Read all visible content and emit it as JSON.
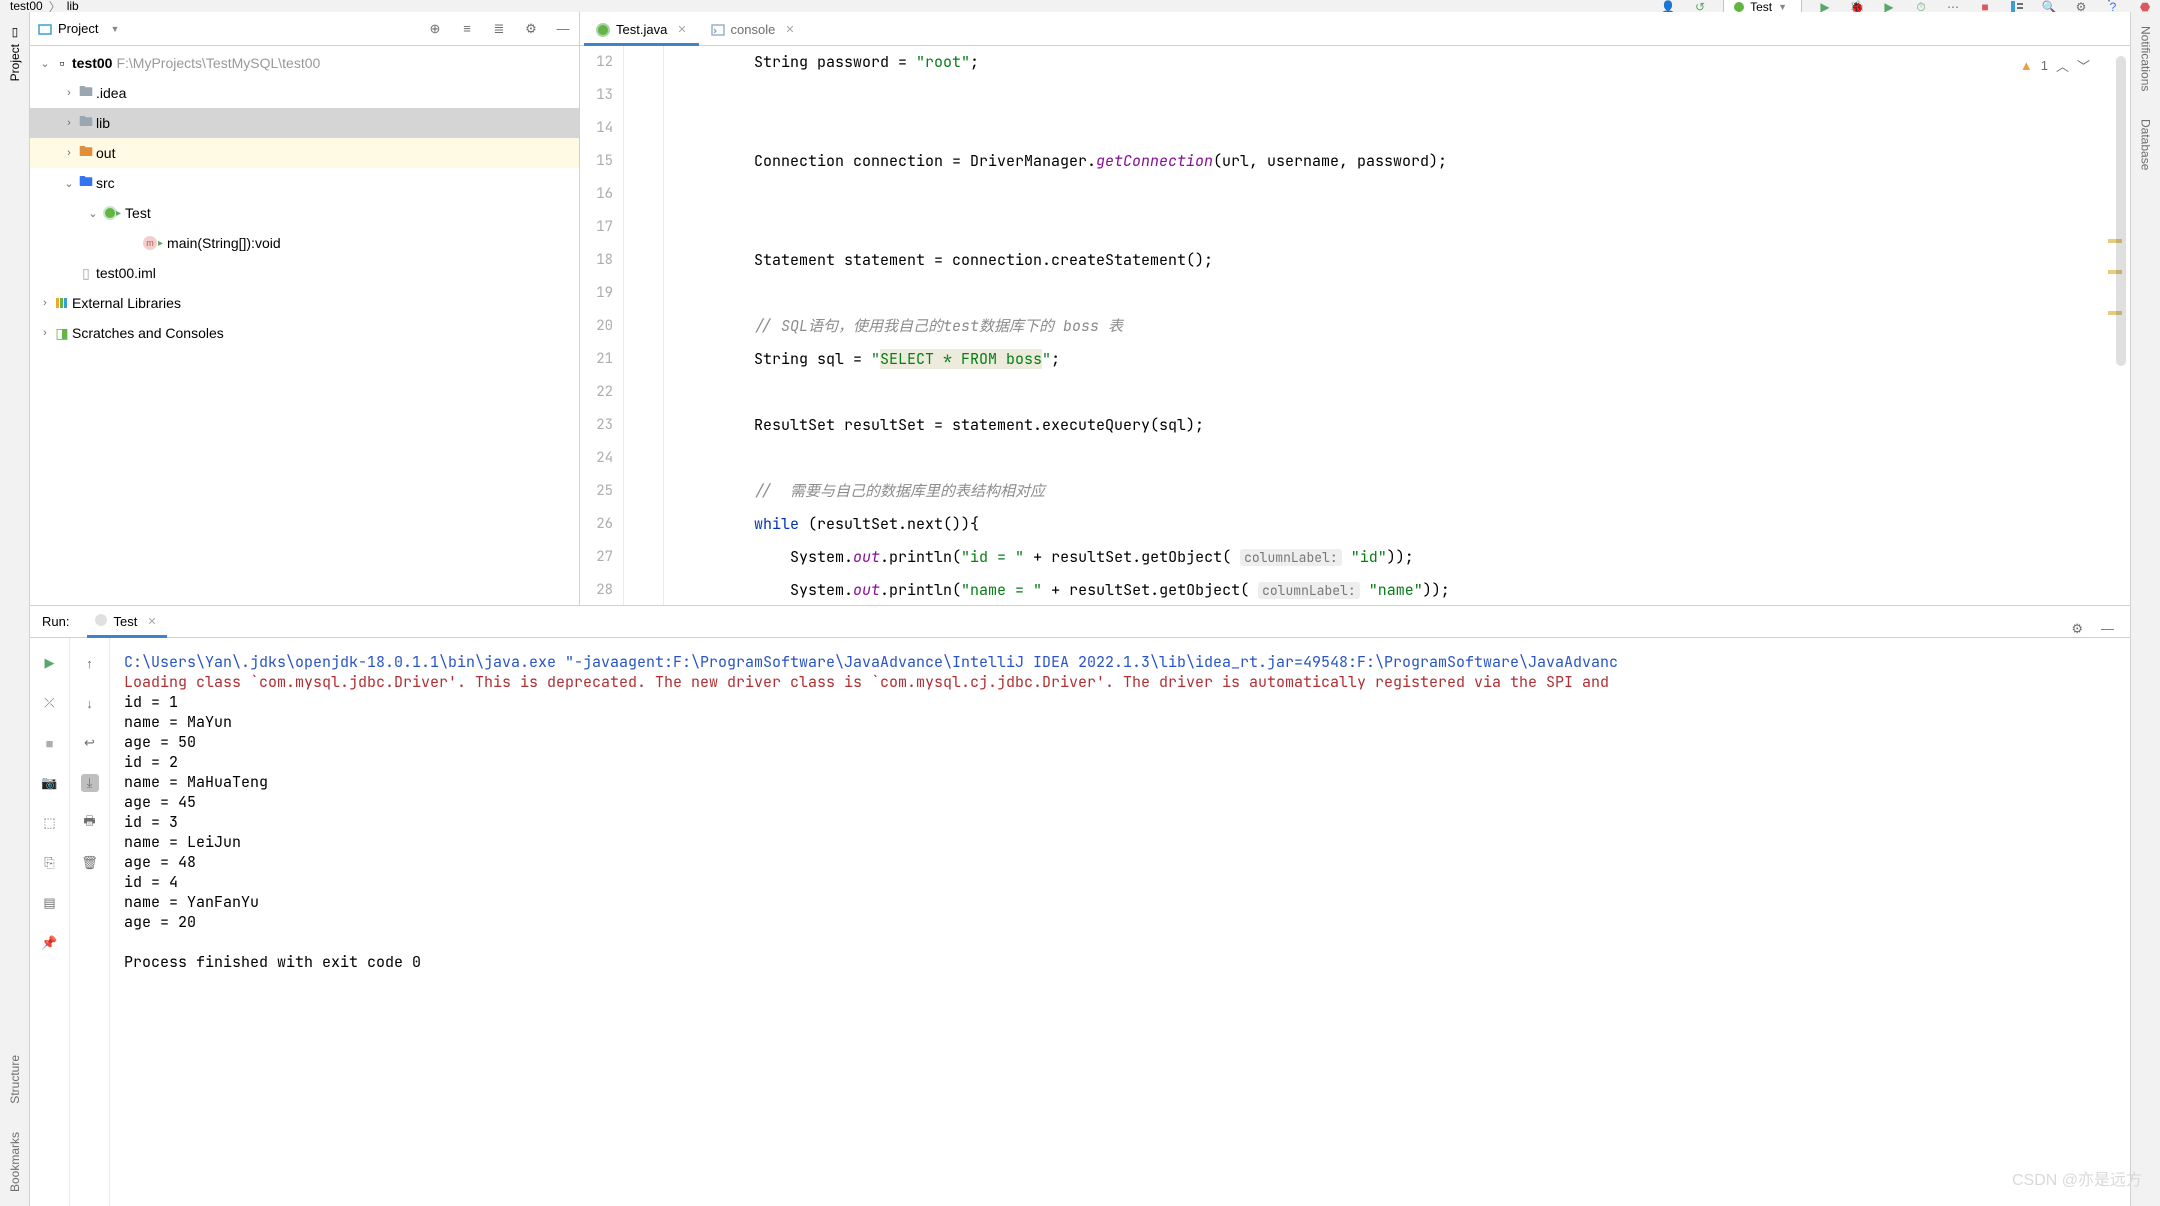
{
  "breadcrumb": {
    "a": "test00",
    "b": "lib"
  },
  "runConfig": "Test",
  "projectHeader": "Project",
  "projectTree": {
    "root": {
      "name": "test00",
      "path": "F:\\MyProjects\\TestMySQL\\test00"
    },
    "idea": ".idea",
    "lib": "lib",
    "out": "out",
    "src": "src",
    "testCls": "Test",
    "mainM": "main(String[]):void",
    "iml": "test00.iml",
    "ext": "External Libraries",
    "scratch": "Scratches and Consoles"
  },
  "tabs": {
    "file": "Test.java",
    "console": "console"
  },
  "warn": {
    "count": "1"
  },
  "gutter": [
    "12",
    "13",
    "14",
    "15",
    "16",
    "17",
    "18",
    "19",
    "20",
    "21",
    "22",
    "23",
    "24",
    "25",
    "26",
    "27",
    "28"
  ],
  "code": {
    "l12a": "String password = ",
    "l12b": "\"root\"",
    "l12c": ";",
    "l15a": "Connection connection = DriverManager.",
    "l15b": "getConnection",
    "l15c": "(url, username, password);",
    "l18": "Statement statement = connection.createStatement();",
    "l19": "// SQL语句，使用我自己的test数据库下的 boss 表",
    "l21a": "String sql = ",
    "l21b": "\"",
    "l21c": "SELECT * FROM boss",
    "l21d": "\"",
    "l21e": ";",
    "l23": "ResultSet resultSet = statement.executeQuery(sql);",
    "l25": "//  需要与自己的数据库里的表结构相对应",
    "l26a": "while",
    "l26b": " (resultSet.next()){",
    "l27a": "    System.",
    "l27b": "out",
    "l27c": ".println(",
    "l27d": "\"id = \"",
    "l27e": " + resultSet.getObject( ",
    "l27h": "columnLabel:",
    "l27f": " \"id\"",
    "l27g": "));",
    "l28a": "    System.",
    "l28b": "out",
    "l28c": ".println(",
    "l28d": "\"name = \"",
    "l28e": " + resultSet.getObject( ",
    "l28h": "columnLabel:",
    "l28f": " \"name\"",
    "l28g": "));"
  },
  "run": {
    "title": "Run:",
    "tab": "Test",
    "cmd": "C:\\Users\\Yan\\.jdks\\openjdk-18.0.1.1\\bin\\java.exe \"-javaagent:F:\\ProgramSoftware\\JavaAdvance\\IntelliJ IDEA 2022.1.3\\lib\\idea_rt.jar=49548:F:\\ProgramSoftware\\JavaAdvanc",
    "err": "Loading class `com.mysql.jdbc.Driver'. This is deprecated. The new driver class is `com.mysql.cj.jdbc.Driver'. The driver is automatically registered via the SPI and",
    "out": [
      "id = 1",
      "name = MaYun",
      "age = 50",
      "id = 2",
      "name = MaHuaTeng",
      "age = 45",
      "id = 3",
      "name = LeiJun",
      "age = 48",
      "id = 4",
      "name = YanFanYu",
      "age = 20"
    ],
    "exit": "Process finished with exit code 0"
  },
  "sideTools": {
    "project": "Project",
    "structure": "Structure",
    "bookmarks": "Bookmarks",
    "notifications": "Notifications",
    "database": "Database"
  },
  "watermark": "CSDN @亦是远方"
}
